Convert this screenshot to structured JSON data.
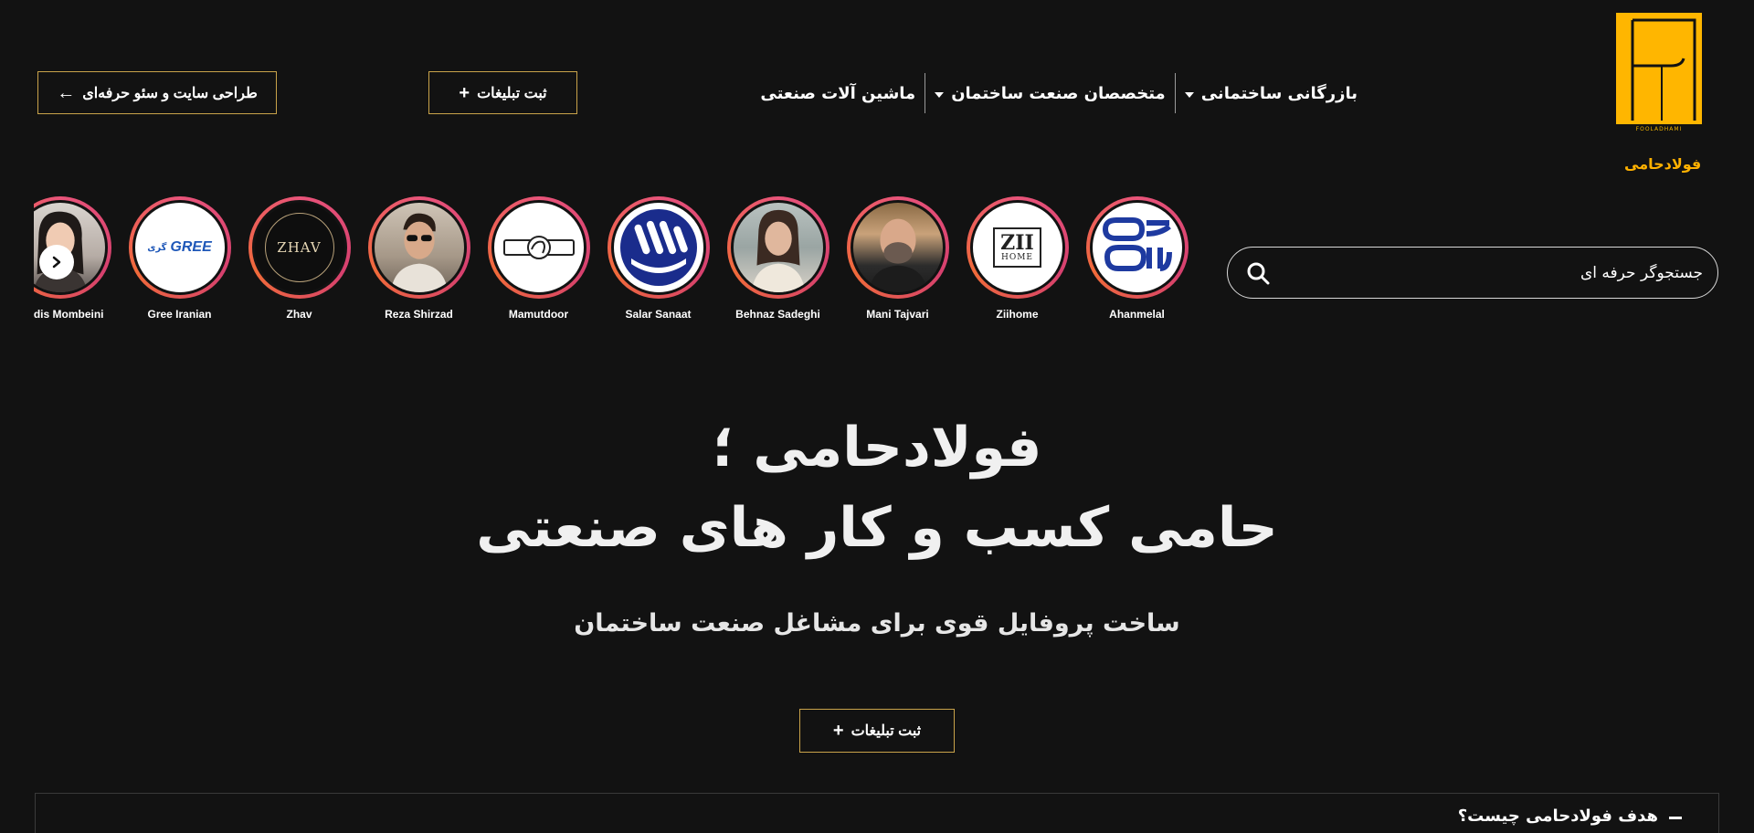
{
  "brand": {
    "logo_small": "FOOLADHAMI",
    "name": "فولادحامی",
    "accent": "#ffb100"
  },
  "header": {
    "seo_button": "طراحی سایت و سئو حرفه‌ای",
    "seo_icon": "arrow-left-icon",
    "register_button": "ثبت تبلیغات",
    "register_icon": "plus-icon"
  },
  "nav": {
    "items": [
      {
        "label": "بازرگانی ساختمانی",
        "has_dropdown": true
      },
      {
        "label": "متخصصان صنعت ساختمان",
        "has_dropdown": true
      },
      {
        "label": "ماشین آلات صنعتی",
        "has_dropdown": false
      }
    ]
  },
  "search": {
    "placeholder": "جستجوگر حرفه ای",
    "icon": "search-icon"
  },
  "stories": [
    {
      "label": "Ahanmelal",
      "kind": "logo-ahanmelal"
    },
    {
      "label": "Ziihome",
      "kind": "logo-ziihome"
    },
    {
      "label": "Mani Tajvari",
      "kind": "photo"
    },
    {
      "label": "Behnaz Sadeghi",
      "kind": "photo"
    },
    {
      "label": "Salar Sanaat",
      "kind": "logo-salar"
    },
    {
      "label": "Mamutdoor",
      "kind": "logo-mamut"
    },
    {
      "label": "Reza Shirzad",
      "kind": "photo"
    },
    {
      "label": "Zhav",
      "kind": "logo-zhav"
    },
    {
      "label": "Gree Iranian",
      "kind": "logo-gree"
    },
    {
      "label": "Pardis Mombeini",
      "kind": "photo"
    }
  ],
  "stories_logos": {
    "ziihome": "ZII",
    "ziihome_sub": "HOME",
    "zhav": "ZHAV",
    "gree": "GREE",
    "gree_fa": "گری"
  },
  "hero": {
    "title_line1": "فولادحامی ؛",
    "title_line2": "حامی کسب و کار های صنعتی",
    "subtitle": "ساخت پروفایل قوی برای مشاغل صنعت ساختمان",
    "cta": "ثبت تبلیغات"
  },
  "faq": {
    "question": "هدف فولادحامی چیست؟"
  }
}
